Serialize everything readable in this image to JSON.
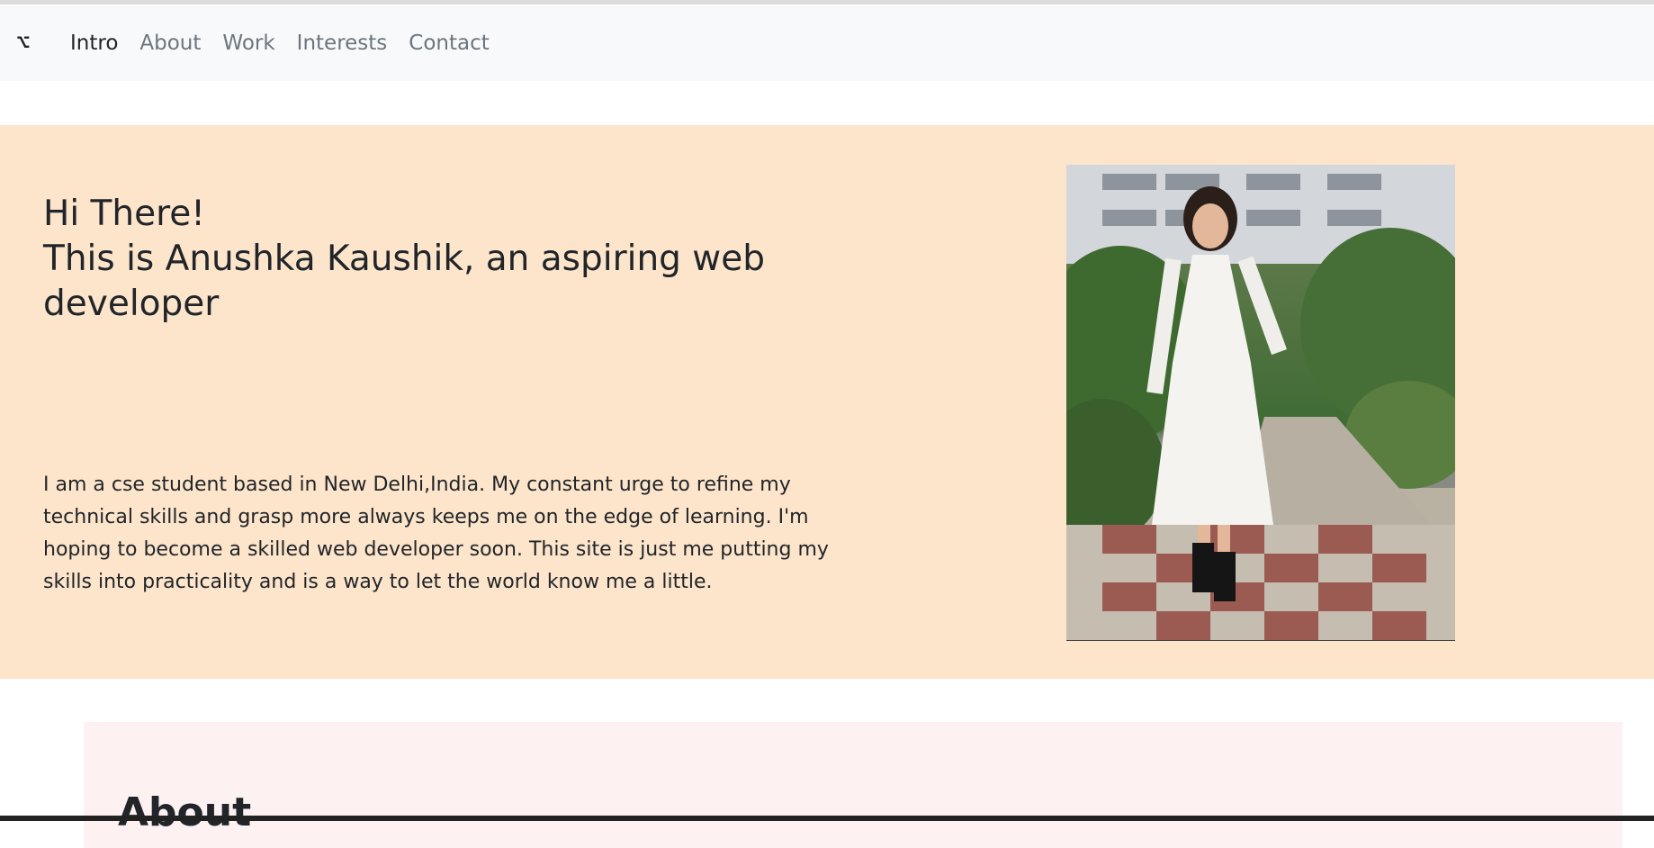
{
  "nav": {
    "brand_symbol": "⌥",
    "links": [
      {
        "label": "Intro",
        "active": true
      },
      {
        "label": "About",
        "active": false
      },
      {
        "label": "Work",
        "active": false
      },
      {
        "label": "Interests",
        "active": false
      },
      {
        "label": "Contact",
        "active": false
      }
    ]
  },
  "intro": {
    "heading_line1": "Hi There!",
    "heading_line2": "This is Anushka Kaushik, an aspiring web developer",
    "text": "I am a cse student based in New Delhi,India. My constant urge to refine my technical skills and grasp more always keeps me on the edge of learning. I'm hoping to become a skilled web developer soon. This site is just me putting my skills into practicality and is a way to let the world know me a little.",
    "background_color": "#fde5cb"
  },
  "about": {
    "heading": "About",
    "background_color": "#fdf1f2"
  }
}
